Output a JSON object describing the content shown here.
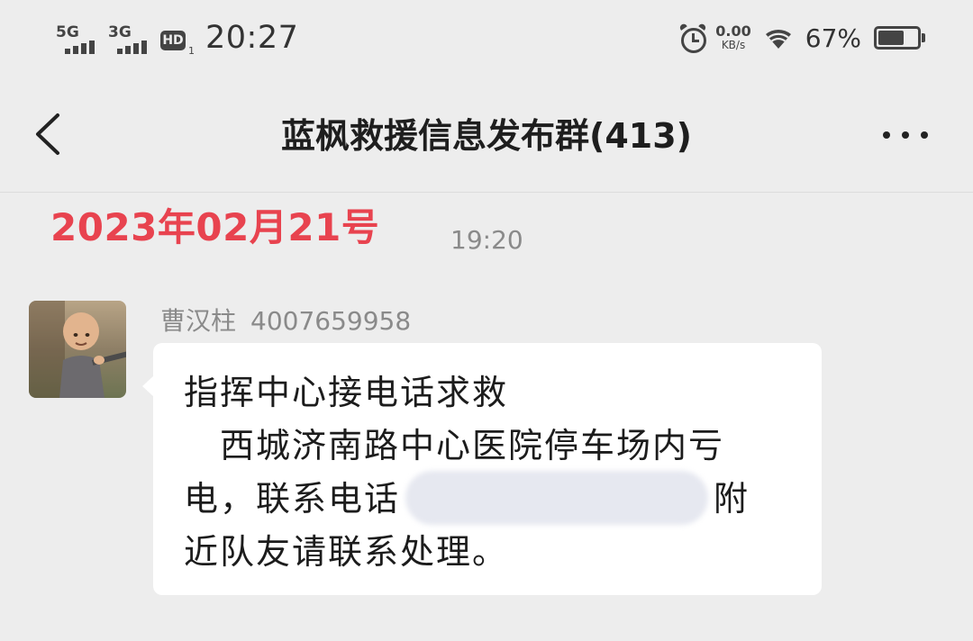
{
  "status_bar": {
    "sim1_network": "5G",
    "sim2_network": "3G",
    "hd_label": "HD",
    "hd_sub": "1",
    "time": "20:27",
    "net_speed_value": "0.00",
    "net_speed_unit": "KB/s",
    "battery_percent_text": "67%",
    "battery_level": 0.67
  },
  "nav": {
    "title": "蓝枫救援信息发布群(413)"
  },
  "chat": {
    "date_stamp": "2023年02月21号",
    "message_time": "19:20",
    "message": {
      "sender_name": "曹汉柱",
      "sender_id": "4007659958",
      "line1": "指挥中心接电话求救",
      "line2": "西城济南路中心医院停车场内亏",
      "line3_prefix": "电，联系电话",
      "line3_suffix": "附",
      "line4": "近队友请联系处理。"
    }
  },
  "colors": {
    "background": "#ededed",
    "bubble": "#ffffff",
    "date_stamp": "#e8434f",
    "muted_text": "#8a8a8a"
  }
}
